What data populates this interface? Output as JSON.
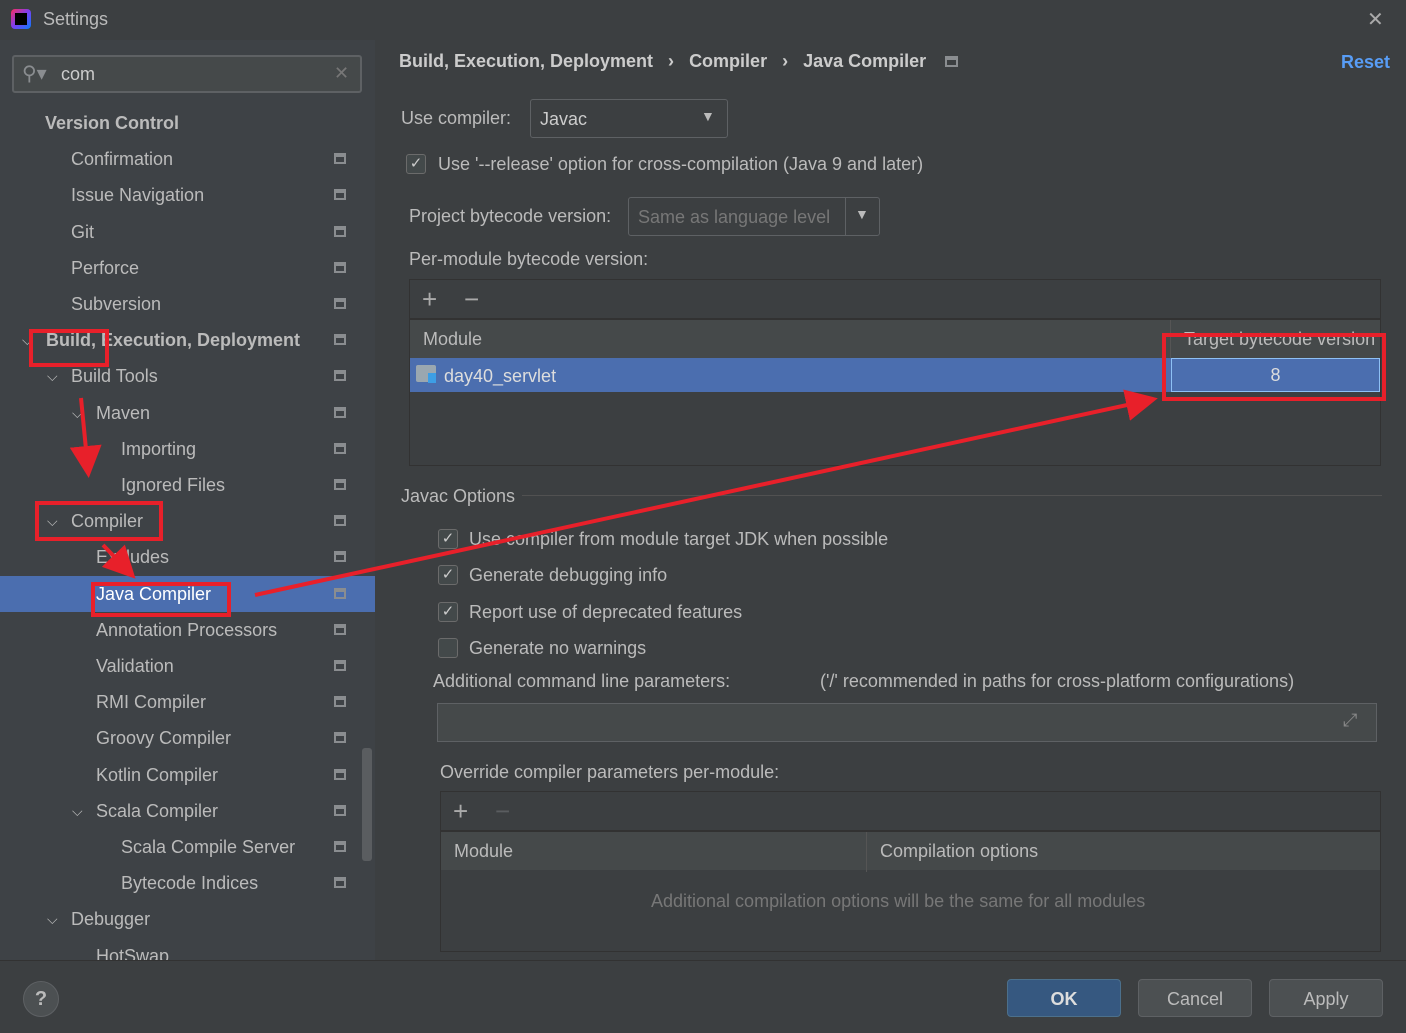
{
  "window": {
    "title": "Settings",
    "close": "✕"
  },
  "search": {
    "value": "com",
    "clear": "✕"
  },
  "sidebar": {
    "items": [
      {
        "label": "Version Control"
      },
      {
        "label": "Confirmation"
      },
      {
        "label": "Issue Navigation"
      },
      {
        "label": "Git"
      },
      {
        "label": "Perforce"
      },
      {
        "label": "Subversion"
      },
      {
        "label": "Build, Execution, Deployment"
      },
      {
        "label": "Build Tools"
      },
      {
        "label": "Maven"
      },
      {
        "label": "Importing"
      },
      {
        "label": "Ignored Files"
      },
      {
        "label": "Compiler"
      },
      {
        "label": "Excludes"
      },
      {
        "label": "Java Compiler"
      },
      {
        "label": "Annotation Processors"
      },
      {
        "label": "Validation"
      },
      {
        "label": "RMI Compiler"
      },
      {
        "label": "Groovy Compiler"
      },
      {
        "label": "Kotlin Compiler"
      },
      {
        "label": "Scala Compiler"
      },
      {
        "label": "Scala Compile Server"
      },
      {
        "label": "Bytecode Indices"
      },
      {
        "label": "Debugger"
      },
      {
        "label": "HotSwap"
      }
    ]
  },
  "breadcrumb": {
    "items": [
      "Build, Execution, Deployment",
      "Compiler",
      "Java Compiler"
    ],
    "sep": "›",
    "reset": "Reset"
  },
  "main": {
    "use_compiler_label": "Use compiler:",
    "use_compiler_value": "Javac",
    "release_option": {
      "label": "Use '--release' option for cross-compilation (Java 9 and later)",
      "checked": true
    },
    "project_bytecode_label": "Project bytecode version:",
    "project_bytecode_placeholder": "Same as language level",
    "per_module_label": "Per-module bytecode version:",
    "table": {
      "columns": [
        "Module",
        "Target bytecode version"
      ],
      "rows": [
        {
          "module": "day40_servlet",
          "version": "8"
        }
      ]
    },
    "javac_options_label": "Javac Options",
    "options": [
      {
        "label": "Use compiler from module target JDK when possible",
        "checked": true
      },
      {
        "label": "Generate debugging info",
        "checked": true
      },
      {
        "label": "Report use of deprecated features",
        "checked": true
      },
      {
        "label": "Generate no warnings",
        "checked": false
      }
    ],
    "cmd_params_label": "Additional command line parameters:",
    "cmd_params_hint": "('/' recommended in paths for cross-platform configurations)",
    "override_label": "Override compiler parameters per-module:",
    "override_table": {
      "columns": [
        "Module",
        "Compilation options"
      ],
      "empty_text": "Additional compilation options will be the same for all modules"
    }
  },
  "footer": {
    "help": "?",
    "ok": "OK",
    "cancel": "Cancel",
    "apply": "Apply"
  },
  "colors": {
    "selection": "#4b6eaf",
    "annotation": "#e8202a",
    "link": "#589df6"
  }
}
